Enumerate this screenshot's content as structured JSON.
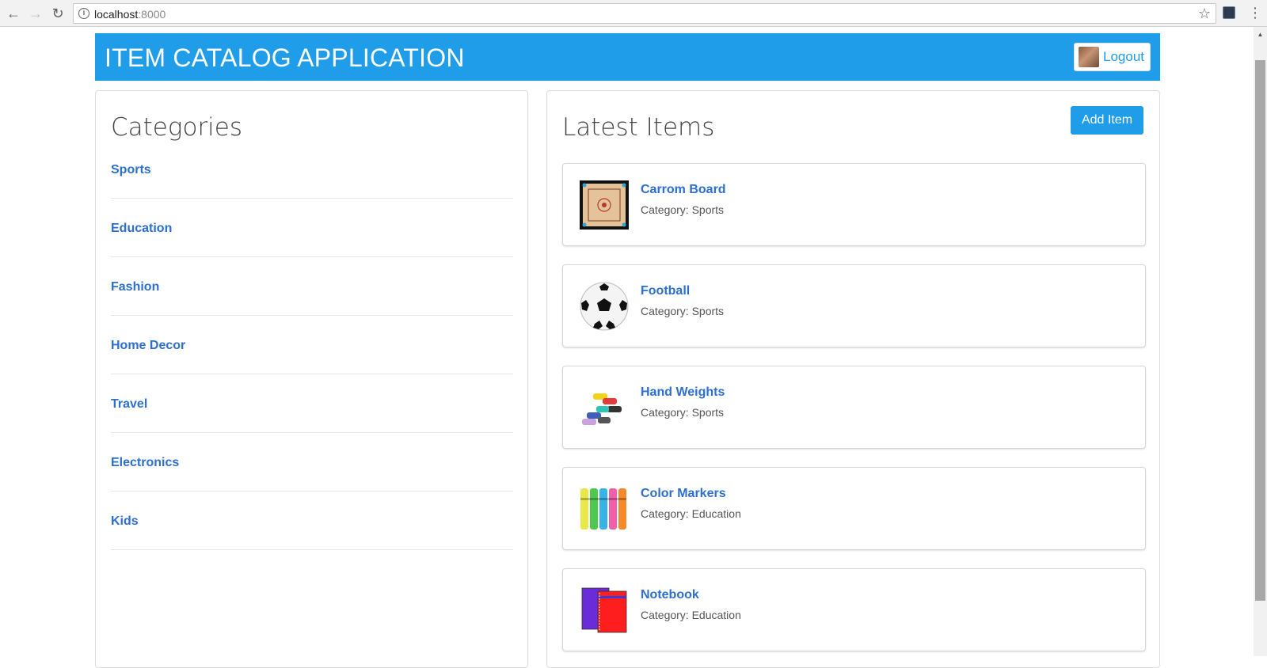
{
  "browser": {
    "url_host": "localhost",
    "url_port": ":8000"
  },
  "header": {
    "title": "ITEM CATALOG APPLICATION",
    "logout_label": "Logout"
  },
  "categories": {
    "heading": "Categories",
    "items": [
      "Sports",
      "Education",
      "Fashion",
      "Home Decor",
      "Travel",
      "Electronics",
      "Kids"
    ]
  },
  "latest": {
    "heading": "Latest Items",
    "add_label": "Add Item",
    "items": [
      {
        "name": "Carrom Board",
        "category": "Category: Sports",
        "icon": "carrom-board-image"
      },
      {
        "name": "Football",
        "category": "Category: Sports",
        "icon": "football-image"
      },
      {
        "name": "Hand Weights",
        "category": "Category: Sports",
        "icon": "hand-weights-image"
      },
      {
        "name": "Color Markers",
        "category": "Category: Education",
        "icon": "color-markers-image"
      },
      {
        "name": "Notebook",
        "category": "Category: Education",
        "icon": "notebook-image"
      }
    ]
  },
  "colors": {
    "accent": "#209de8",
    "link": "#2c6fd1"
  }
}
